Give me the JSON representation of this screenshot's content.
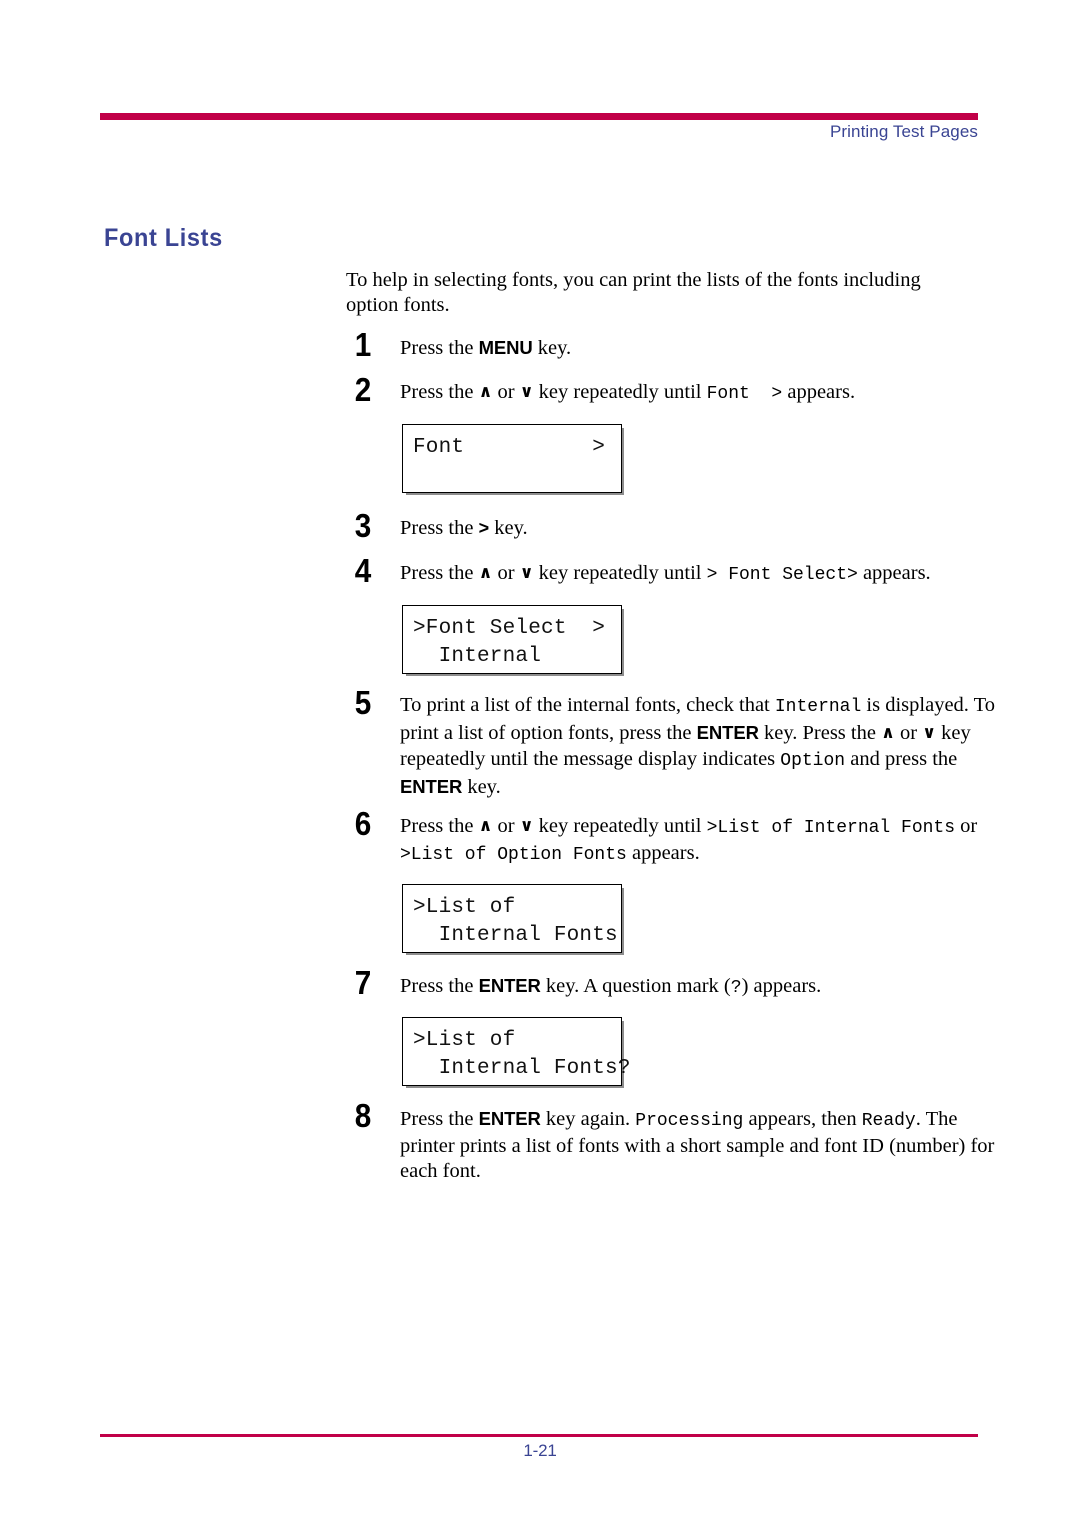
{
  "header": {
    "running_title": "Printing Test Pages",
    "rule_color": "#C10048",
    "text_color": "#3A4493"
  },
  "heading": {
    "title": "Font Lists"
  },
  "intro": {
    "paragraph": "To help in selecting fonts, you can print the lists of the fonts including option fonts."
  },
  "steps": {
    "s1": {
      "number": "1",
      "pre": "Press the ",
      "key": "MENU",
      "post": " key."
    },
    "s2": {
      "number": "2",
      "pre": "Press the ",
      "up": "∧",
      "mid": " or ",
      "down": "∨",
      "post": " key repeatedly until ",
      "mono": "Font  >",
      "tail": " appears."
    },
    "s3": {
      "number": "3",
      "pre": "Press the ",
      "key": ">",
      "post": " key."
    },
    "s4": {
      "number": "4",
      "pre": "Press the ",
      "up": "∧",
      "mid": " or ",
      "down": "∨",
      "post": " key repeatedly until ",
      "mono": "> Font Select>",
      "tail": " appears."
    },
    "s5": {
      "number": "5",
      "t1": "To print a list of the internal fonts, check that ",
      "m1": "Internal",
      "t2": " is displayed. To print a list of option fonts, press the ",
      "k1": "ENTER",
      "t3": " key. Press the ",
      "up": "∧",
      "t4": " or ",
      "down": "∨",
      "t5": " key repeatedly until the message display indicates ",
      "m2": "Option",
      "t6": " and press the ",
      "k2": "ENTER",
      "t7": " key."
    },
    "s6": {
      "number": "6",
      "pre": "Press the ",
      "up": "∧",
      "mid": " or ",
      "down": "∨",
      "post": " key repeatedly until ",
      "mono1": ">List of Internal Fonts",
      "mid2": " or ",
      "mono2": ">List of Option Fonts",
      "tail": " appears."
    },
    "s7": {
      "number": "7",
      "pre": "Press the ",
      "key": "ENTER",
      "mid": " key. A question mark (",
      "mono": "?",
      "post": ") appears."
    },
    "s8": {
      "number": "8",
      "pre": "Press the ",
      "key": "ENTER",
      "mid": " key again. ",
      "mono1": "Processing",
      "mid2": " appears, then ",
      "mono2": "Ready",
      "tail": ". The printer prints a list of fonts with a short sample and font ID (number) for each font."
    }
  },
  "displays": {
    "d1": {
      "line1": "Font          >",
      "line2": ""
    },
    "d2": {
      "line1": ">Font Select  >",
      "line2": "  Internal"
    },
    "d3": {
      "line1": ">List of",
      "line2": "  Internal Fonts"
    },
    "d4": {
      "line1": ">List of",
      "line2": "  Internal Fonts?"
    }
  },
  "footer": {
    "page_number": "1-21",
    "rule_color": "#C10048",
    "text_color": "#3A4493"
  }
}
